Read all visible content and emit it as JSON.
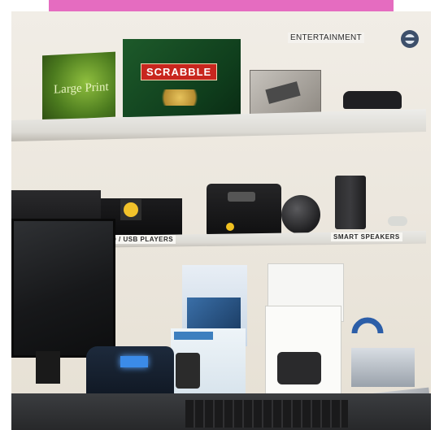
{
  "banner_color": "#e56cc0",
  "labels": {
    "entertainment": "ENTERTAINMENT",
    "players": "D / USB PLAYERS",
    "speakers": "SMART SPEAKERS"
  },
  "products": {
    "scrabble_title": "SCRABBLE",
    "large_print": "Large Print"
  },
  "icons": {
    "entertainment": "entertainment-icon"
  }
}
